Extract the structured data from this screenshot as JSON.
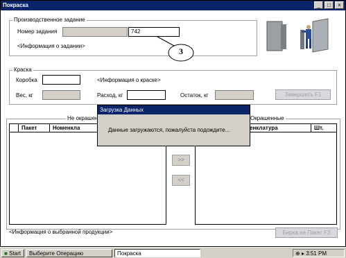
{
  "window": {
    "title": "Покраска",
    "buttons": {
      "minimize": "_",
      "maximize": "□",
      "close": "×"
    }
  },
  "task_group": {
    "title": "Производственное задание",
    "task_number_label": "Номер задания",
    "task_number_value": "742",
    "info": "<Информация о задании>",
    "callout": "3"
  },
  "paint_group": {
    "title": "Краска",
    "box_label": "Коробка",
    "paint_info": "<Информация о краске>",
    "weight_label": "Вес, кг",
    "consumption_label": "Расход, кг",
    "remainder_label": "Остаток, кг",
    "finish_button": "Завершить    F1"
  },
  "lists": {
    "left_title": "Не окрашен",
    "right_title": "Окрашенные",
    "left_columns": [
      "Пакет",
      "Номенкла"
    ],
    "right_columns": [
      "енклатура",
      "Шт."
    ],
    "move_right": ">>",
    "move_left": "<<"
  },
  "selected_info": "<Информация о выбранной продукции>",
  "tag_button": "Бирка на Пакет   F2",
  "dialog": {
    "title": "Загрузка Данных",
    "message": "Данные загружаются, пожалуйста подождите..."
  },
  "taskbar": {
    "start": "Start",
    "items": [
      "Выберите Операцию",
      "Покраска"
    ],
    "time": "3:51 PM"
  }
}
